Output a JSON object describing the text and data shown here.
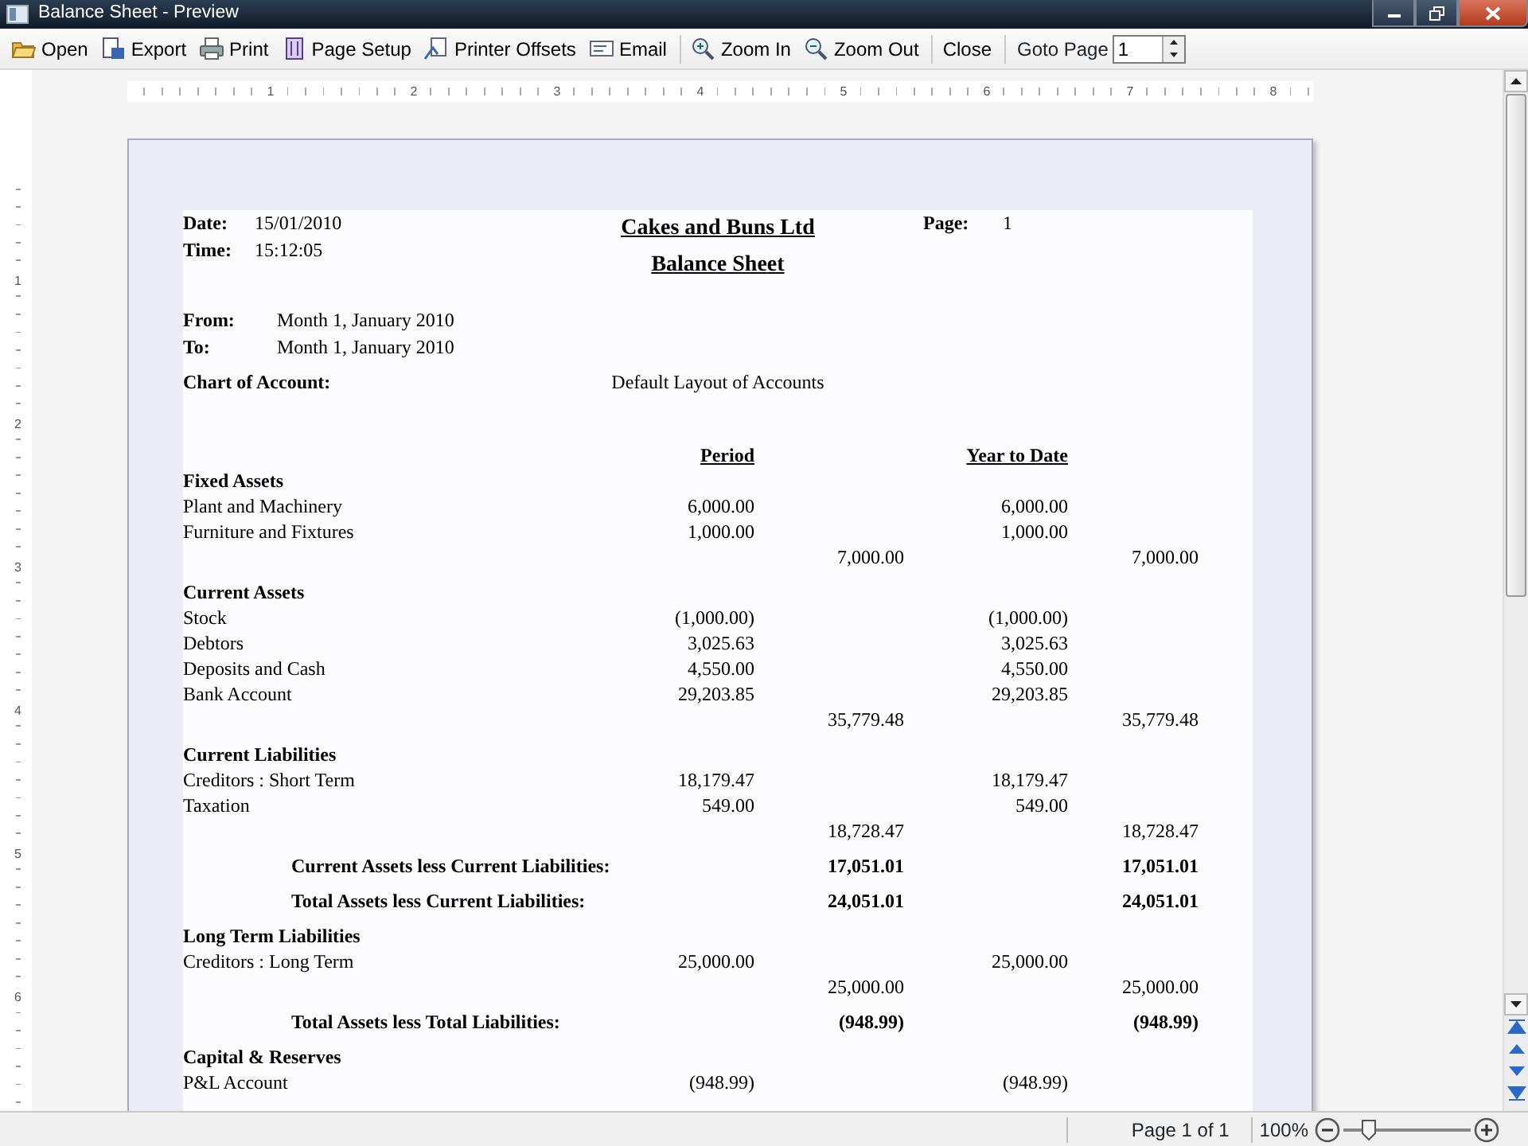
{
  "window": {
    "title": "Balance Sheet - Preview"
  },
  "toolbar": {
    "buttons": [
      {
        "label": "Open",
        "separator_after": false
      },
      {
        "label": "Export",
        "separator_after": false
      },
      {
        "label": "Print",
        "separator_after": false
      },
      {
        "label": "Page Setup",
        "separator_after": false
      },
      {
        "label": "Printer Offsets",
        "separator_after": false
      },
      {
        "label": "Email",
        "separator_after": true
      },
      {
        "label": "Zoom In",
        "separator_after": false
      },
      {
        "label": "Zoom Out",
        "separator_after": true
      },
      {
        "label": "Close",
        "separator_after": true
      }
    ],
    "goto_page": {
      "label": "Goto Page",
      "value": "1"
    }
  },
  "horizontal_ruler": [
    "1",
    "2",
    "3",
    "4",
    "5",
    "6",
    "7",
    "8"
  ],
  "vertical_ruler": [
    "1",
    "2",
    "3",
    "4",
    "5",
    "6"
  ],
  "report": {
    "date_label": "Date:",
    "date": "15/01/2010",
    "time_label": "Time:",
    "time": "15:12:05",
    "company": "Cakes and Buns Ltd",
    "title": "Balance Sheet",
    "page_label": "Page:",
    "page": "1",
    "from_label": "From:",
    "from": "Month 1, January 2010",
    "to_label": "To:",
    "to": "Month 1, January 2010",
    "chart_label": "Chart of Account:",
    "chart": "Default Layout of Accounts",
    "columns": [
      "Period",
      "Year to Date"
    ],
    "rows": [
      {
        "kind": "section",
        "label": "Fixed Assets"
      },
      {
        "kind": "line",
        "label": "Plant and Machinery",
        "period": "6,000.00",
        "ytd": "6,000.00"
      },
      {
        "kind": "line",
        "label": "Furniture and Fixtures",
        "period": "1,000.00",
        "ytd": "1,000.00"
      },
      {
        "kind": "total",
        "period_total": "7,000.00",
        "ytd_total": "7,000.00"
      },
      {
        "kind": "section",
        "label": "Current Assets"
      },
      {
        "kind": "line",
        "label": "Stock",
        "period": "(1,000.00)",
        "ytd": "(1,000.00)"
      },
      {
        "kind": "line",
        "label": "Debtors",
        "period": "3,025.63",
        "ytd": "3,025.63"
      },
      {
        "kind": "line",
        "label": "Deposits and Cash",
        "period": "4,550.00",
        "ytd": "4,550.00"
      },
      {
        "kind": "line",
        "label": "Bank Account",
        "period": "29,203.85",
        "ytd": "29,203.85"
      },
      {
        "kind": "total",
        "period_total": "35,779.48",
        "ytd_total": "35,779.48"
      },
      {
        "kind": "section",
        "label": "Current Liabilities"
      },
      {
        "kind": "line",
        "label": "Creditors : Short Term",
        "period": "18,179.47",
        "ytd": "18,179.47"
      },
      {
        "kind": "line",
        "label": "Taxation",
        "period": "549.00",
        "ytd": "549.00"
      },
      {
        "kind": "total",
        "period_total": "18,728.47",
        "ytd_total": "18,728.47"
      },
      {
        "kind": "summary",
        "label": "Current Assets less Current Liabilities:",
        "period_total": "17,051.01",
        "ytd_total": "17,051.01"
      },
      {
        "kind": "summary",
        "label": "Total Assets less Current Liabilities:",
        "period_total": "24,051.01",
        "ytd_total": "24,051.01"
      },
      {
        "kind": "section",
        "label": "Long Term Liabilities"
      },
      {
        "kind": "line",
        "label": "Creditors : Long Term",
        "period": "25,000.00",
        "ytd": "25,000.00"
      },
      {
        "kind": "total",
        "period_total": "25,000.00",
        "ytd_total": "25,000.00"
      },
      {
        "kind": "summary",
        "label": "Total Assets less Total Liabilities:",
        "period_total": "(948.99)",
        "ytd_total": "(948.99)"
      },
      {
        "kind": "section",
        "label": "Capital & Reserves"
      },
      {
        "kind": "line",
        "label": "P&L Account",
        "period": "(948.99)",
        "ytd": "(948.99)"
      }
    ]
  },
  "status_bar": {
    "page_info": "Page 1 of 1",
    "zoom": "100%",
    "zoom_slider": {
      "level": 0.2
    }
  }
}
